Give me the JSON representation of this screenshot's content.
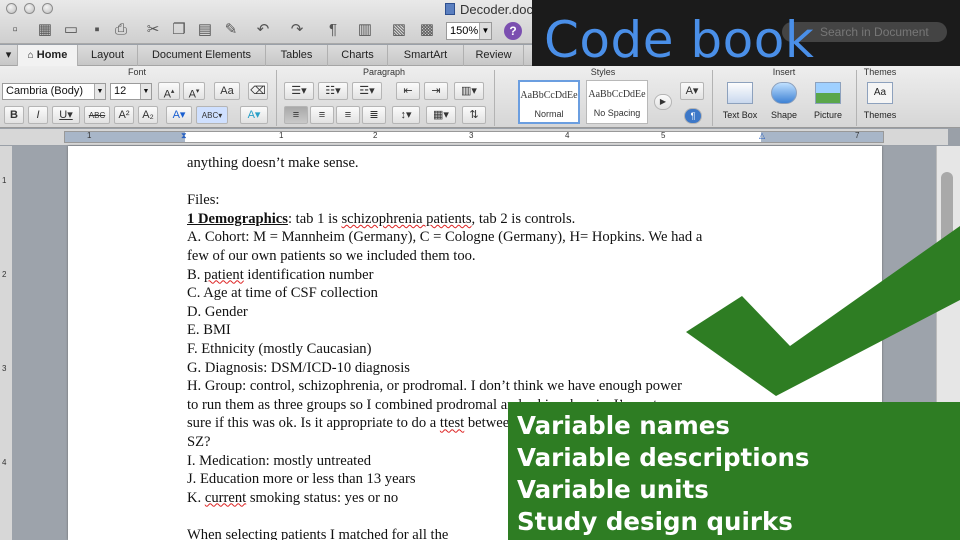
{
  "window": {
    "title": "Decoder.docx",
    "zoom": "150%"
  },
  "overlay": {
    "heading": "Code book",
    "search_placeholder": "Search in Document"
  },
  "ribbon": {
    "tabs": [
      {
        "label": "Home",
        "active": true
      },
      {
        "label": "Layout"
      },
      {
        "label": "Document Elements"
      },
      {
        "label": "Tables"
      },
      {
        "label": "Charts"
      },
      {
        "label": "SmartArt"
      },
      {
        "label": "Review"
      }
    ],
    "groups": {
      "font": "Font",
      "paragraph": "Paragraph",
      "styles": "Styles",
      "insert": "Insert",
      "themes": "Themes"
    },
    "font_name": "Cambria (Body)",
    "font_size": "12",
    "styles": [
      {
        "sample": "AaBbCcDdEe",
        "name": "Normal",
        "active": true
      },
      {
        "sample": "AaBbCcDdEe",
        "name": "No Spacing"
      }
    ],
    "insert": {
      "text_box": "Text Box",
      "shape": "Shape",
      "picture": "Picture"
    },
    "themes_label": "Themes"
  },
  "ruler": {
    "numbers": [
      "1",
      "1",
      "2",
      "3",
      "4",
      "5",
      "6",
      "7"
    ]
  },
  "vruler": {
    "numbers": [
      "1",
      "2",
      "3",
      "4"
    ]
  },
  "document": {
    "lines": [
      "anything doesn’t make sense.",
      "",
      "Files:",
      "",
      "A. Cohort: M = Mannheim (Germany), C = Cologne (Germany), H= Hopkins. We had a",
      "few of our own patients so we included them too.",
      "",
      "C. Age at time of CSF collection",
      "D. Gender",
      "E. BMI",
      "F. Ethnicity (mostly Caucasian)",
      "G. Diagnosis: DSM/ICD-10 diagnosis",
      "H. Group: control, schizophrenia, or prodromal. I don’t think we have enough power",
      "to run them as three groups so I combined prodromal and schizophrenia. I’m not",
      "",
      "SZ?",
      "I. Medication: mostly untreated",
      "J. Education more or less than 13 years",
      "",
      "",
      "When selecting patients I matched for all the"
    ],
    "demographics_heading": "1 Demographics",
    "demographics_rest_a": ": tab 1 is ",
    "demographics_squiggle": "schizophrenia patients",
    "demographics_rest_b": ", tab 2 is controls.",
    "line_b_prefix": "B. ",
    "line_b_squiggle": "patient",
    "line_b_rest": " identification number",
    "line_sure_a": "sure if this was ok. Is it appropriate to do a ",
    "line_sure_squiggle": "ttest",
    "line_sure_b": " between controls and",
    "line_k_prefix": "K. ",
    "line_k_squiggle": "current",
    "line_k_rest": " smoking status: yes or no"
  },
  "callout": {
    "items": [
      "Variable names",
      "Variable descriptions",
      "Variable units",
      "Study design quirks"
    ],
    "color": "#2e7d23"
  }
}
